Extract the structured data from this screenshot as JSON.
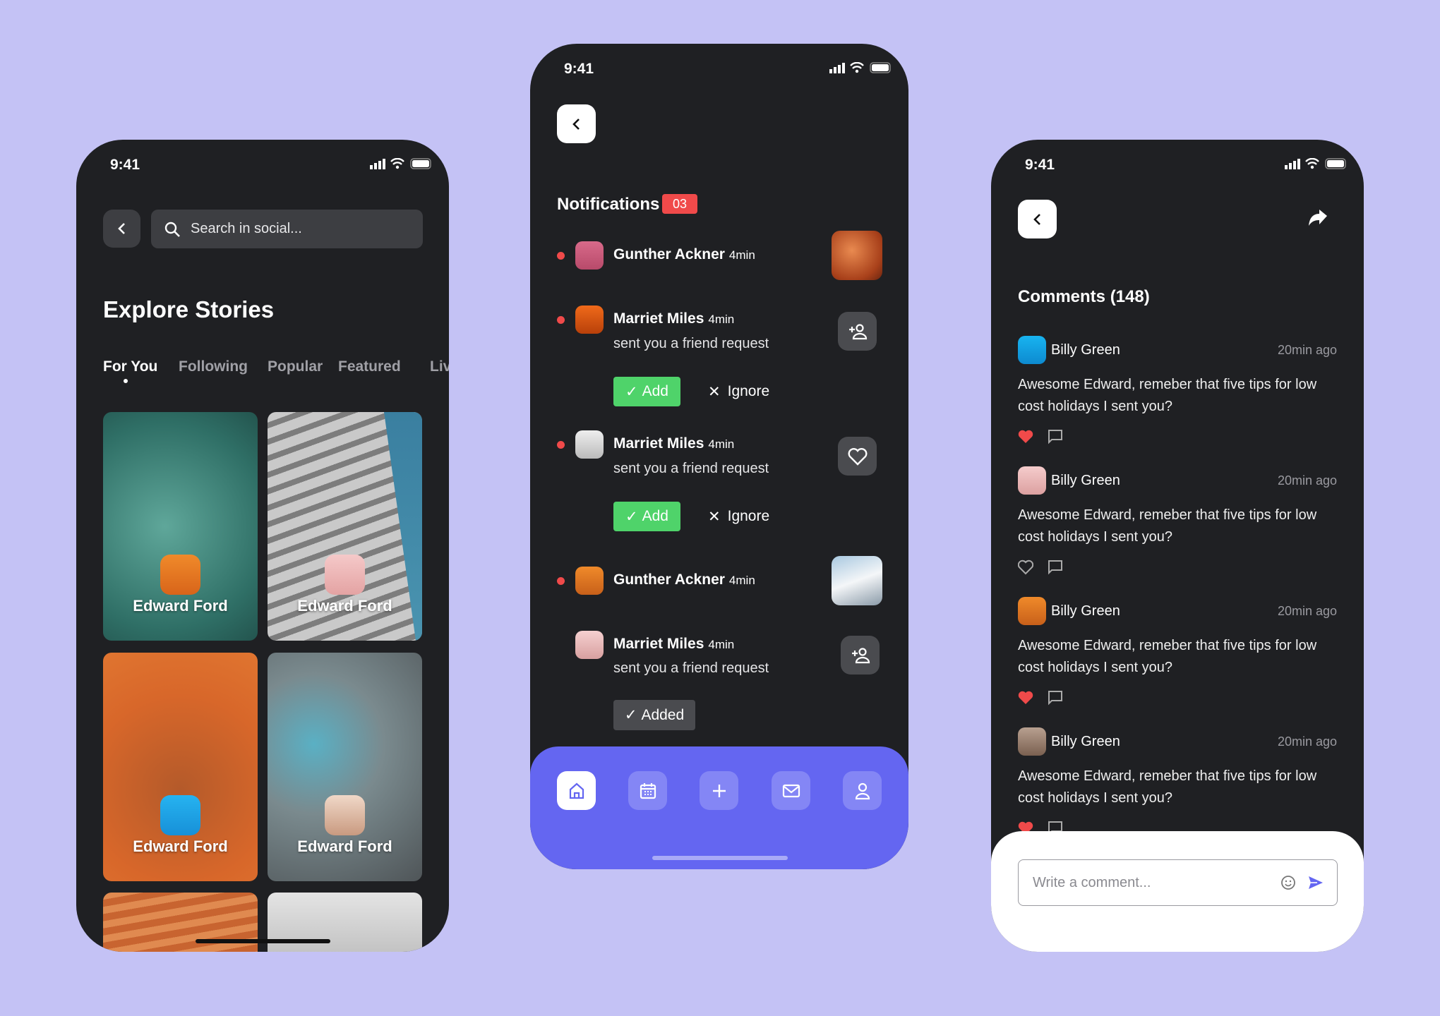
{
  "colors": {
    "background": "#c4c2f5",
    "phone": "#1f2023",
    "accent": "#6466f1",
    "green": "#4fd36a",
    "red": "#f04a4a"
  },
  "status_time": "9:41",
  "explore": {
    "search_placeholder": "Search in social...",
    "title": "Explore Stories",
    "tabs": [
      {
        "label": "For You",
        "active": true
      },
      {
        "label": "Following"
      },
      {
        "label": "Popular"
      },
      {
        "label": "Featured"
      },
      {
        "label": "Live"
      }
    ],
    "cards": [
      {
        "name": "Edward Ford"
      },
      {
        "name": "Edward Ford"
      },
      {
        "name": "Edward Ford"
      },
      {
        "name": "Edward Ford"
      }
    ]
  },
  "notifications": {
    "title": "Notifications",
    "badge": "03",
    "items": [
      {
        "name": "Gunther Ackner",
        "time": "4min",
        "unread": true
      },
      {
        "name": "Marriet Miles",
        "time": "4min",
        "text": "sent you a friend request",
        "unread": true,
        "add": "Add",
        "ignore": "Ignore"
      },
      {
        "name": "Marriet Miles",
        "time": "4min",
        "text": "sent you a friend request",
        "unread": true,
        "add": "Add",
        "ignore": "Ignore"
      },
      {
        "name": "Gunther Ackner",
        "time": "4min",
        "unread": true
      },
      {
        "name": "Marriet Miles",
        "time": "4min",
        "text": "sent you a friend request",
        "unread": false,
        "added": "Added"
      }
    ],
    "nav": [
      "home-icon",
      "calendar-icon",
      "plus-icon",
      "mail-icon",
      "user-icon"
    ]
  },
  "comments": {
    "title": "Comments (148)",
    "items": [
      {
        "name": "Billy Green",
        "time": "20min ago",
        "text": "Awesome Edward, remeber that five tips for low cost holidays I sent you?",
        "liked": true
      },
      {
        "name": "Billy Green",
        "time": "20min ago",
        "text": "Awesome Edward, remeber that five tips for low cost holidays I sent you?",
        "liked": false
      },
      {
        "name": "Billy Green",
        "time": "20min ago",
        "text": "Awesome Edward, remeber that five tips for low cost holidays I sent you?",
        "liked": true
      },
      {
        "name": "Billy Green",
        "time": "20min ago",
        "text": "Awesome Edward, remeber that five tips for low cost holidays I sent you?",
        "liked": true
      }
    ],
    "input_placeholder": "Write a comment..."
  }
}
